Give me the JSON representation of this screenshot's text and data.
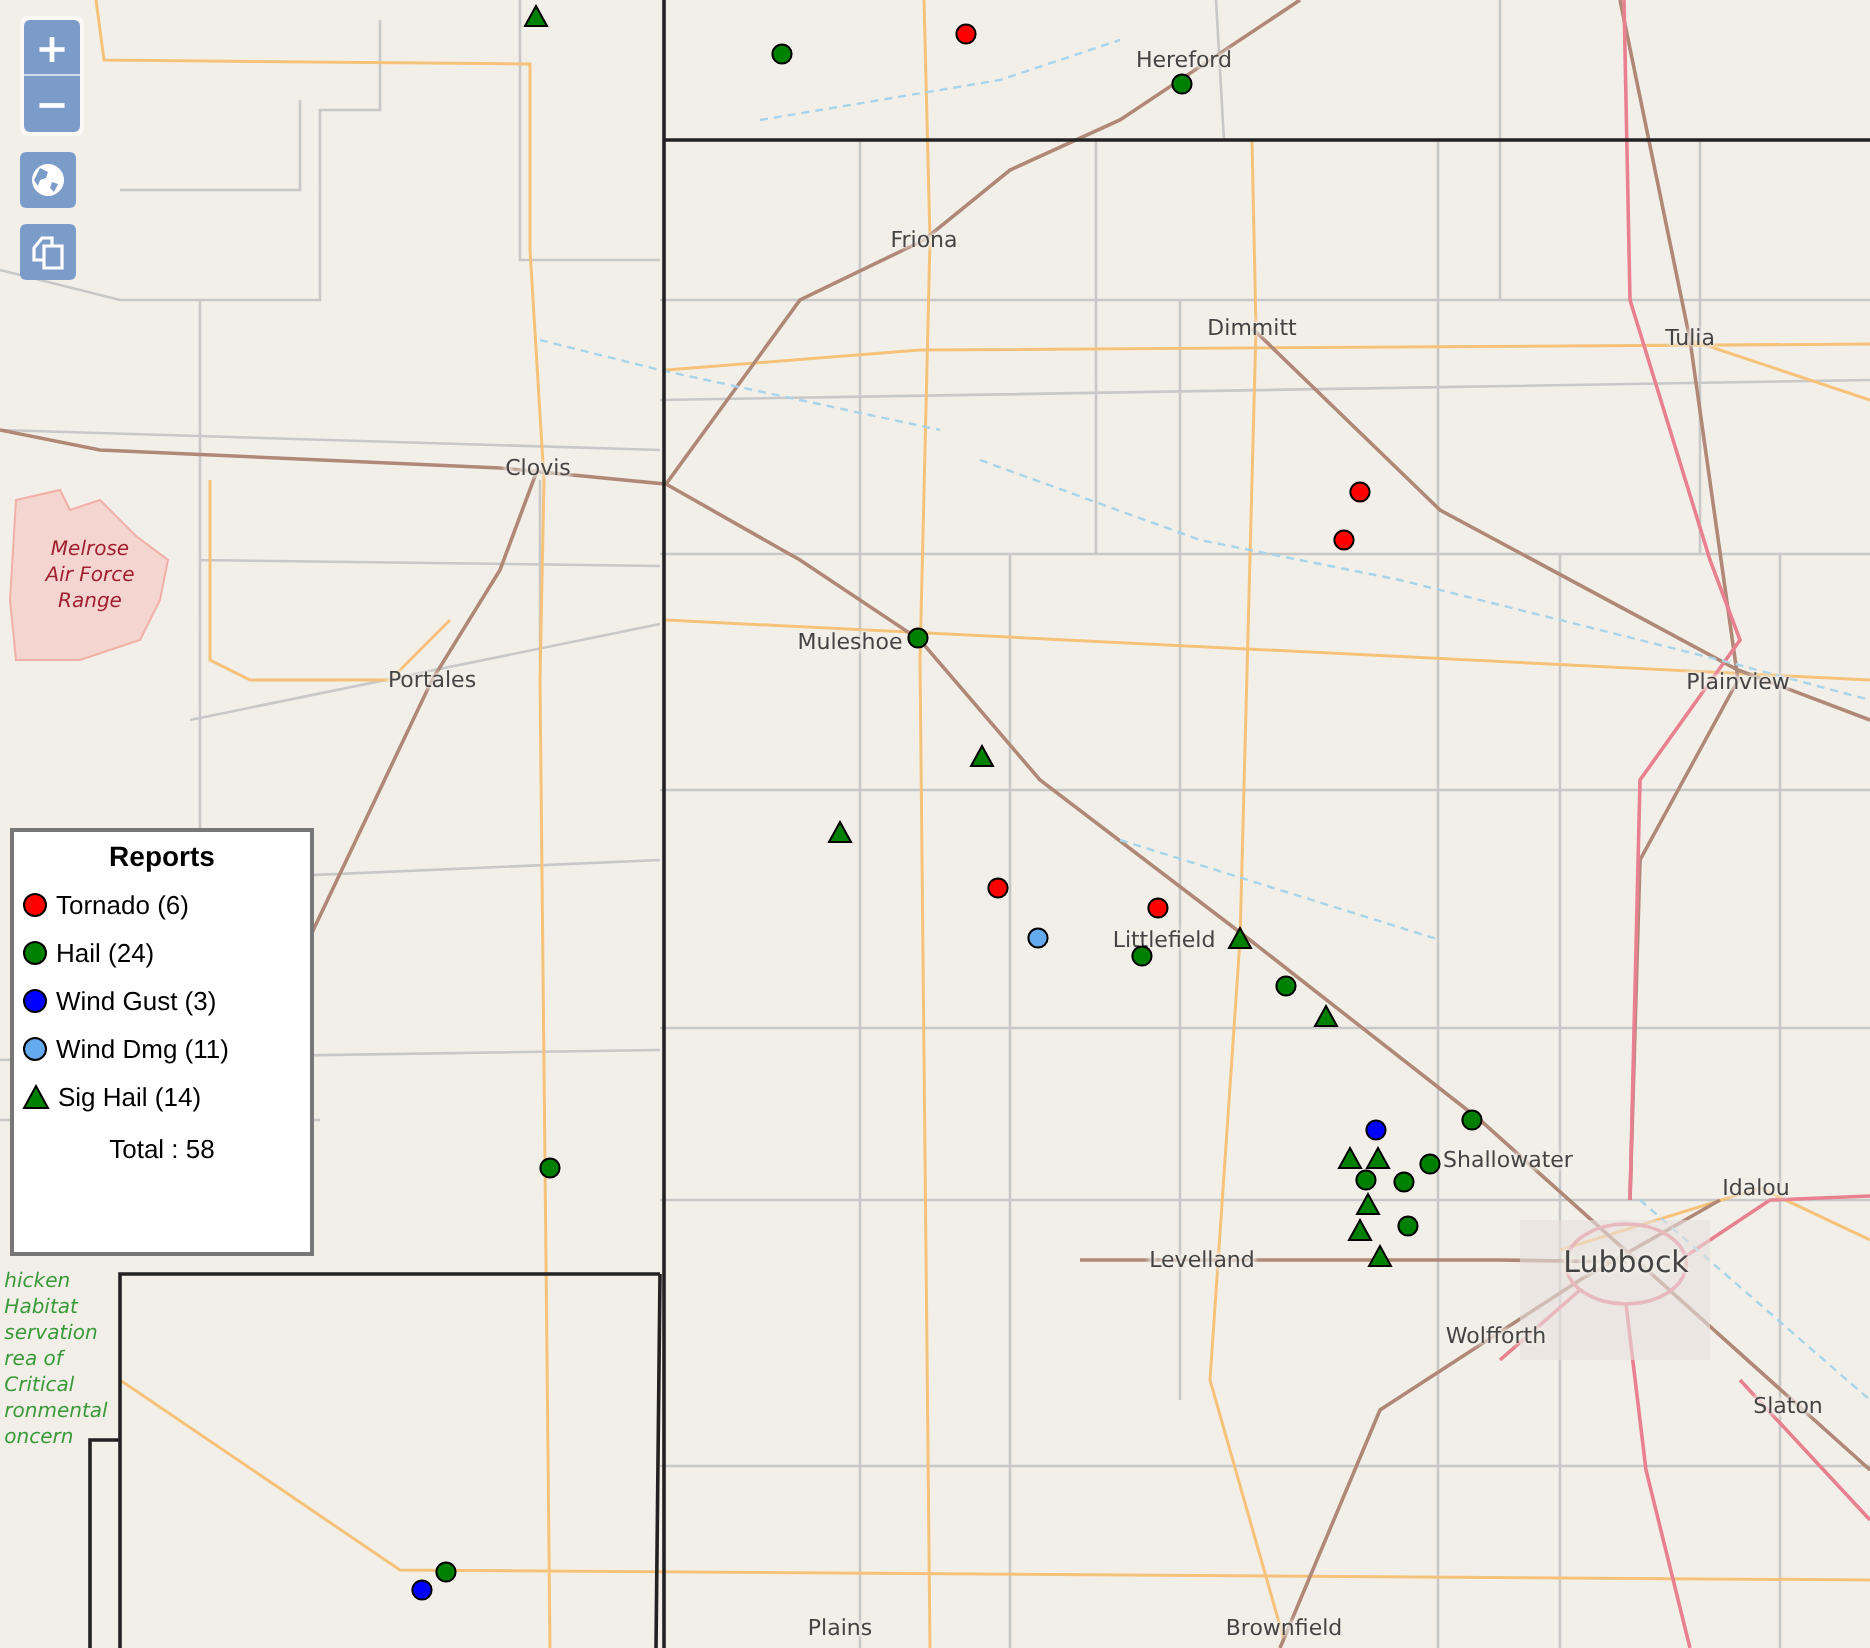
{
  "map_controls": {
    "zoom_in": "+",
    "zoom_out": "−"
  },
  "places": [
    {
      "kind": "city",
      "name": "Hereford"
    },
    {
      "kind": "city",
      "name": "Friona"
    },
    {
      "kind": "city",
      "name": "Dimmitt"
    },
    {
      "kind": "city",
      "name": "Tulia"
    },
    {
      "kind": "city",
      "name": "Clovis"
    },
    {
      "kind": "city",
      "name": "Portales"
    },
    {
      "kind": "city",
      "name": "Muleshoe"
    },
    {
      "kind": "city",
      "name": "Plainview"
    },
    {
      "kind": "city",
      "name": "Littlefield"
    },
    {
      "kind": "city",
      "name": "Shallowater"
    },
    {
      "kind": "city",
      "name": "Idalou"
    },
    {
      "kind": "bigcity",
      "name": "Lubbock"
    },
    {
      "kind": "city",
      "name": "Levelland"
    },
    {
      "kind": "city",
      "name": "Wolfforth"
    },
    {
      "kind": "city",
      "name": "Slaton"
    },
    {
      "kind": "city",
      "name": "Plains"
    },
    {
      "kind": "city",
      "name": "Brownfield"
    },
    {
      "kind": "military",
      "name": "Melrose Air Force Range"
    },
    {
      "kind": "reserve",
      "name": "hicken Habitat servation rea of Critical ronmental oncern"
    }
  ],
  "markers": [
    {
      "kind": "circle",
      "color": "#ff0000"
    },
    {
      "kind": "circle",
      "color": "#ff0000"
    },
    {
      "kind": "circle",
      "color": "#ff0000"
    },
    {
      "kind": "circle",
      "color": "#ff0000"
    },
    {
      "kind": "circle",
      "color": "#ff0000"
    },
    {
      "kind": "circle",
      "color": "#008000"
    },
    {
      "kind": "circle",
      "color": "#008000"
    },
    {
      "kind": "circle",
      "color": "#008000"
    },
    {
      "kind": "circle",
      "color": "#008000"
    },
    {
      "kind": "circle",
      "color": "#008000"
    },
    {
      "kind": "circle",
      "color": "#008000"
    },
    {
      "kind": "circle",
      "color": "#008000"
    },
    {
      "kind": "circle",
      "color": "#008000"
    },
    {
      "kind": "circle",
      "color": "#008000"
    },
    {
      "kind": "circle",
      "color": "#008000"
    },
    {
      "kind": "circle",
      "color": "#008000"
    },
    {
      "kind": "circle",
      "color": "#008000"
    },
    {
      "kind": "circle",
      "color": "#0000ff"
    },
    {
      "kind": "circle",
      "color": "#0000ff"
    },
    {
      "kind": "circle",
      "color": "#66aaee"
    },
    {
      "kind": "triangle",
      "color": "#008000"
    },
    {
      "kind": "triangle",
      "color": "#008000"
    },
    {
      "kind": "triangle",
      "color": "#008000"
    },
    {
      "kind": "triangle",
      "color": "#008000"
    },
    {
      "kind": "triangle",
      "color": "#008000"
    },
    {
      "kind": "triangle",
      "color": "#008000"
    },
    {
      "kind": "triangle",
      "color": "#008000"
    },
    {
      "kind": "triangle",
      "color": "#008000"
    },
    {
      "kind": "triangle",
      "color": "#008000"
    },
    {
      "kind": "triangle",
      "color": "#008000"
    }
  ],
  "legend": {
    "title": "Reports",
    "items": [
      {
        "kind": "circle",
        "color": "#ff0000",
        "label": "Tornado (6)"
      },
      {
        "kind": "circle",
        "color": "#008000",
        "label": "Hail (24)"
      },
      {
        "kind": "circle",
        "color": "#0000ff",
        "label": "Wind Gust (3)"
      },
      {
        "kind": "circle",
        "color": "#66aaee",
        "label": "Wind Dmg (11)"
      },
      {
        "kind": "triangle",
        "color": "#008000",
        "label": "Sig Hail (14)"
      }
    ],
    "total": "Total : 58"
  }
}
